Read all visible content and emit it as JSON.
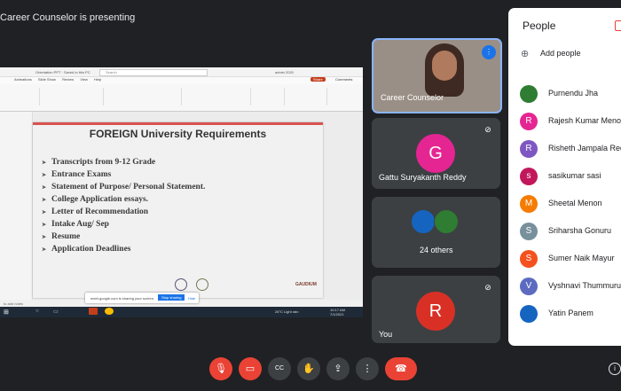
{
  "presenting_banner": "Career Counselor is presenting",
  "presentation": {
    "filename_bar": "Orientation PPT · Saved to this PC",
    "search_placeholder": "Search",
    "user": "admin 2020",
    "share_label": "Share",
    "comments_label": "Comments",
    "tabs": [
      "Animations",
      "Slide Show",
      "Review",
      "View",
      "Help"
    ],
    "slide_title": "FOREIGN University Requirements",
    "bullets": [
      "Transcripts from 9-12 Grade",
      "Entrance Exams",
      "Statement of Purpose/ Personal Statement.",
      "College Application essays.",
      "Letter of Recommendation",
      "Intake Aug/ Sep",
      "Resume",
      "Application Deadlines"
    ],
    "slide_logo": "GAUDIUM",
    "notes_placeholder": "to add notes",
    "share_notice": "meet.google.com is sharing your screen.",
    "stop_sharing": "Stop sharing",
    "hide": "Hide",
    "taskbar_weather": "26°C Light rain",
    "taskbar_time": "10:17 AM",
    "taskbar_date": "7/1/2021"
  },
  "tiles": {
    "presenter": {
      "name": "Career Counselor"
    },
    "gattu": {
      "name": "Gattu Suryakanth Reddy",
      "initial": "G",
      "color": "#e52592"
    },
    "others": {
      "label": "24 others"
    },
    "you": {
      "name": "You",
      "initial": "R",
      "color": "#d93025"
    }
  },
  "people": {
    "title": "People",
    "add_people": "Add people",
    "list": [
      {
        "name": "Purnendu Jha",
        "initial": "",
        "color": "#2e7d32"
      },
      {
        "name": "Rajesh Kumar Menon",
        "initial": "R",
        "color": "#e52592"
      },
      {
        "name": "Risheth Jampala Reddy",
        "initial": "R",
        "color": "#7e57c2"
      },
      {
        "name": "sasikumar sasi",
        "initial": "s",
        "color": "#c2185b"
      },
      {
        "name": "Sheetal Menon",
        "initial": "M",
        "color": "#f57c00"
      },
      {
        "name": "Sriharsha Gonuru",
        "initial": "S",
        "color": "#78909c"
      },
      {
        "name": "Sumer Naik Mayur",
        "initial": "S",
        "color": "#f4511e"
      },
      {
        "name": "Vyshnavi Thummuru",
        "initial": "V",
        "color": "#5c6bc0"
      },
      {
        "name": "Yatin Panem",
        "initial": "",
        "color": "#1565c0"
      }
    ]
  },
  "controls": {
    "mic": "mic-off",
    "camera": "camera-off",
    "captions": "CC",
    "raise_hand": "hand",
    "present": "present",
    "more": "more",
    "hangup": "hangup"
  },
  "colors": {
    "accent": "#8ab4f8",
    "danger": "#ea4335"
  }
}
